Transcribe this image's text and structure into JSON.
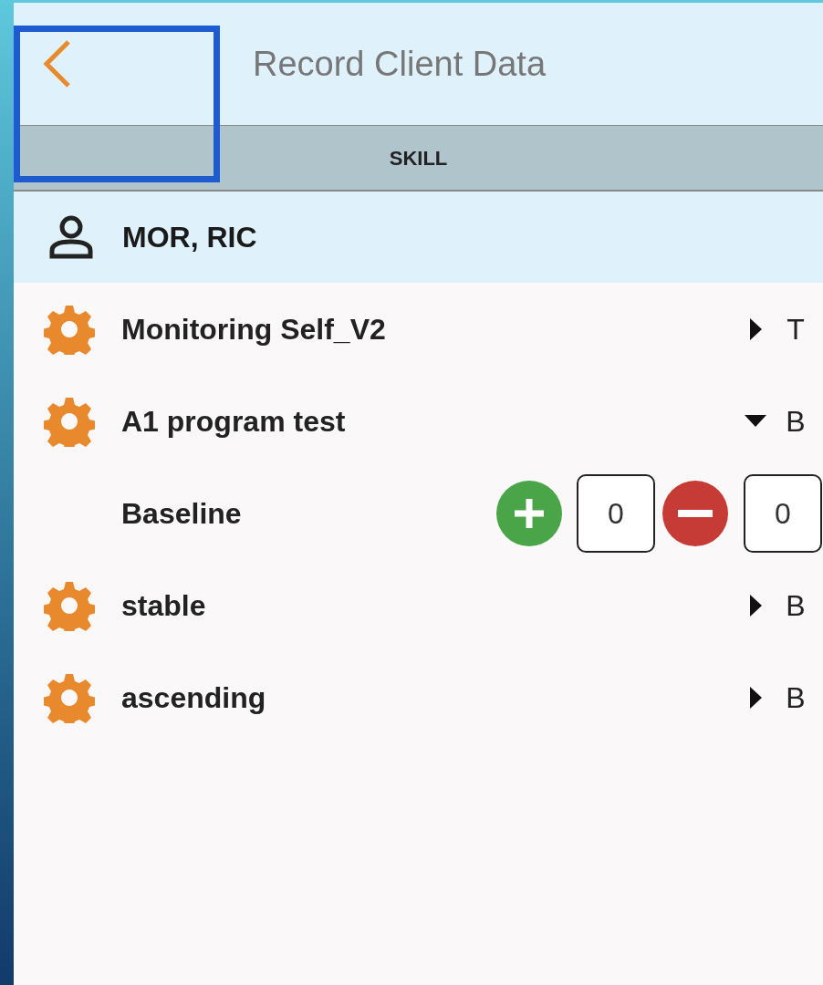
{
  "header": {
    "title": "Record Client Data"
  },
  "tabs": [
    {
      "label": "SKILL",
      "selected": true
    }
  ],
  "client": {
    "name": "MOR, RIC"
  },
  "programs": [
    {
      "name": "Monitoring Self_V2",
      "letter": "T",
      "expanded": false
    },
    {
      "name": "A1 program test",
      "letter": "B",
      "expanded": true,
      "phases": [
        {
          "name": "Baseline",
          "plus_count": "0",
          "minus_count": "0"
        }
      ]
    },
    {
      "name": "stable",
      "letter": "B",
      "expanded": false
    },
    {
      "name": "ascending",
      "letter": "B",
      "expanded": false
    }
  ]
}
